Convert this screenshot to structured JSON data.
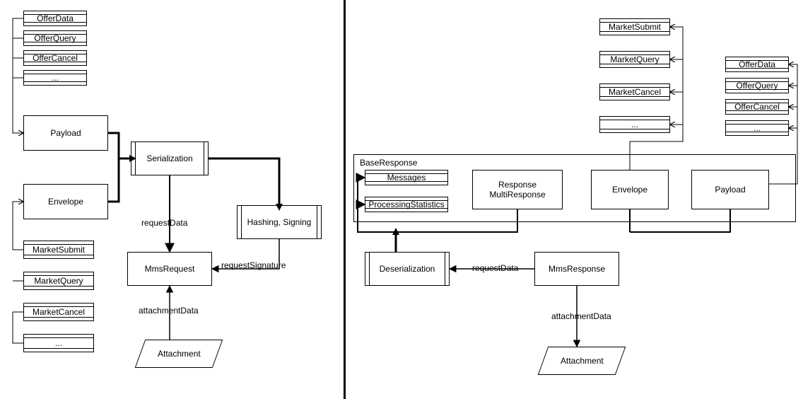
{
  "left": {
    "offer_list": [
      "OfferData",
      "OfferQuery",
      "OfferCancel",
      "..."
    ],
    "payload": "Payload",
    "envelope": "Envelope",
    "market_list": [
      "MarketSubmit",
      "MarketQuery",
      "MarketCancel",
      "..."
    ],
    "serialization": "Serialization",
    "hashing": "Hashing, Signing",
    "mms_request": "MmsRequest",
    "attachment": "Attachment",
    "labels": {
      "requestData": "requestData",
      "requestSignature": "requestSignature",
      "attachmentData": "attachmentData"
    }
  },
  "right": {
    "market_list": [
      "MarketSubmit",
      "MarketQuery",
      "MarketCancel",
      "..."
    ],
    "offer_list": [
      "OfferData",
      "OfferQuery",
      "OfferCancel",
      "..."
    ],
    "base_response": "BaseResponse",
    "messages": "Messages",
    "processing_statistics": "ProcessingStatistics",
    "response_multi": "Response\nMultiResponse",
    "envelope": "Envelope",
    "payload": "Payload",
    "deserialization": "Deserialization",
    "mms_response": "MmsResponse",
    "attachment": "Attachment",
    "labels": {
      "requestData": "requestData",
      "attachmentData": "attachmentData"
    }
  }
}
